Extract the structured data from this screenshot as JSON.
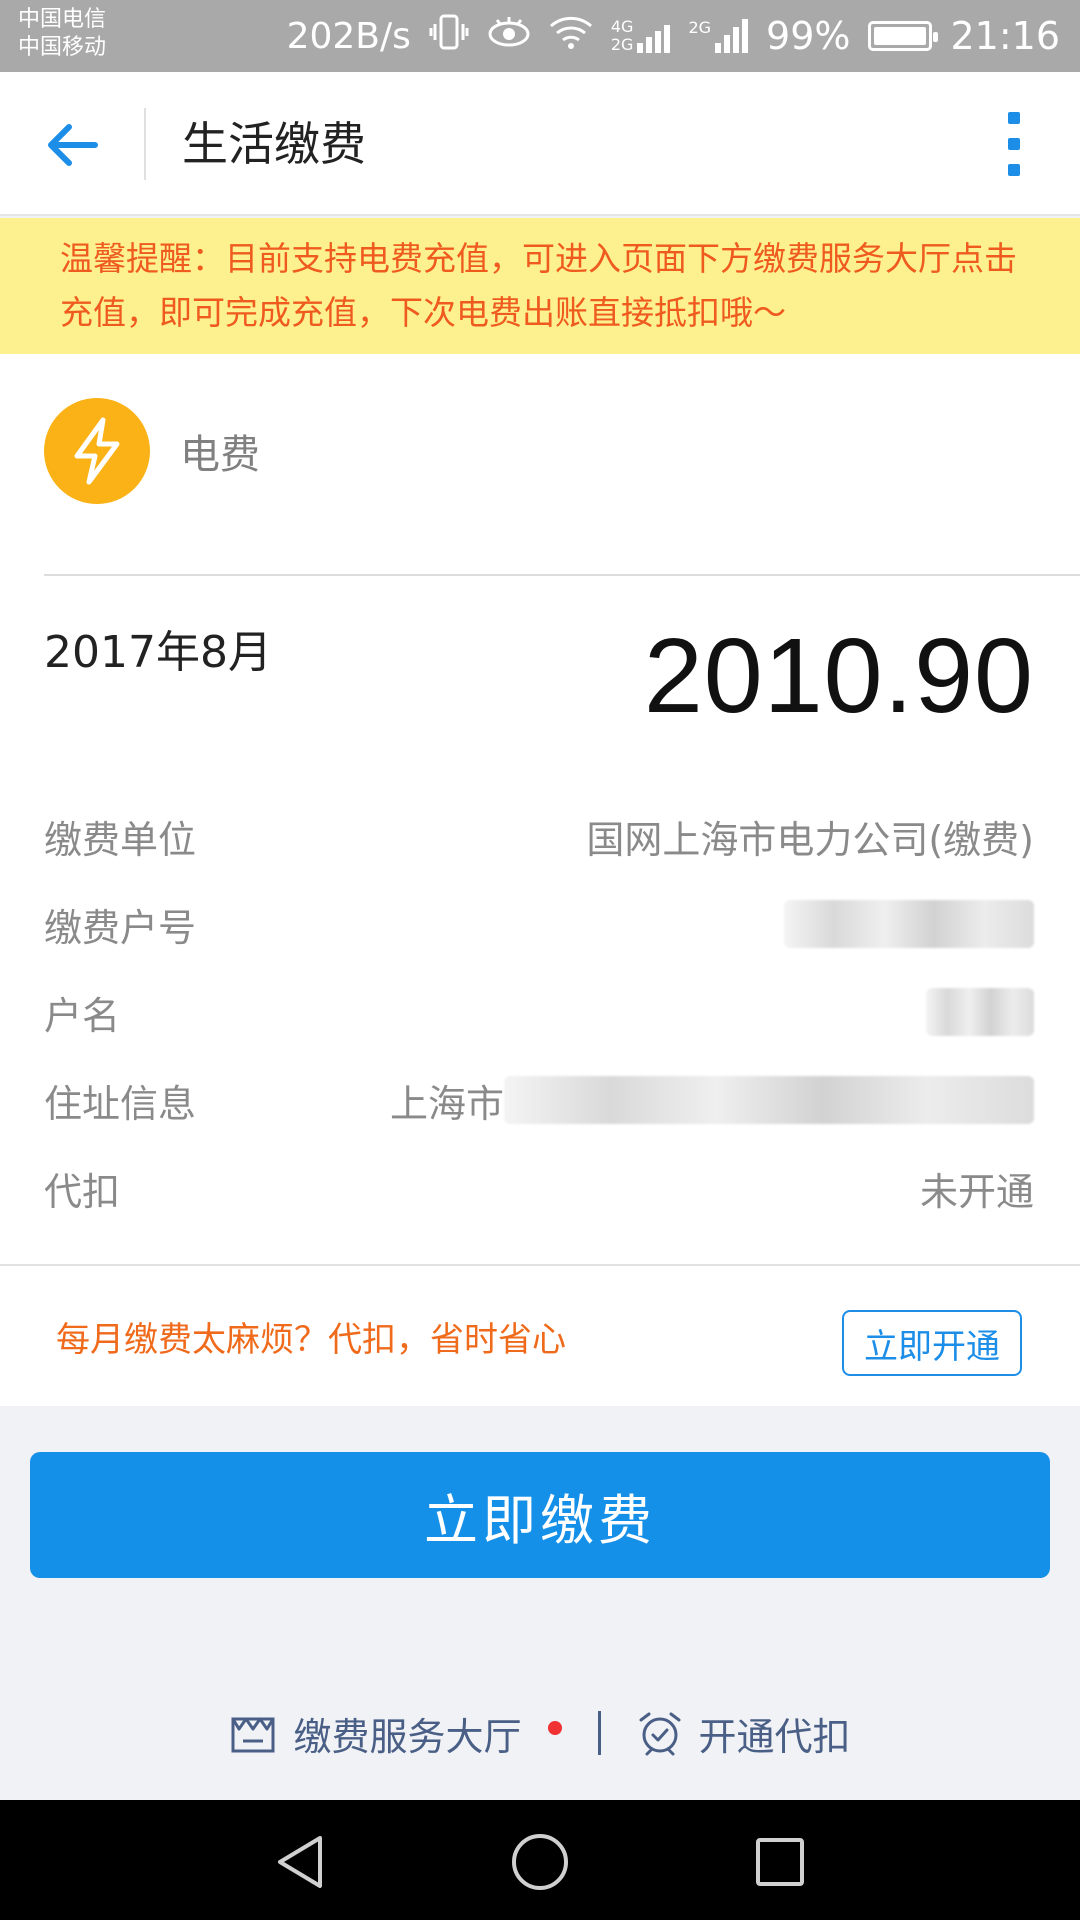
{
  "status_bar": {
    "carrier_1": "中国电信",
    "carrier_2": "中国移动",
    "net_speed": "202B/s",
    "battery": "99%",
    "time": "21:16",
    "network_label_a": "4G",
    "network_label_b": "2G",
    "network_label_c": "2G"
  },
  "header": {
    "title": "生活缴费"
  },
  "notice": {
    "text": "温馨提醒：目前支持电费充值，可进入页面下方缴费服务大厅点击充值，即可完成充值，下次电费出账直接抵扣哦～"
  },
  "bill": {
    "type_label": "电费",
    "month": "2017年8月",
    "amount": "2010.90",
    "rows": [
      {
        "label": "缴费单位",
        "value": "国网上海市电力公司(缴费)"
      },
      {
        "label": "缴费户号",
        "value": ""
      },
      {
        "label": "户名",
        "value": ""
      },
      {
        "label": "住址信息",
        "value": "上海市"
      },
      {
        "label": "代扣",
        "value": "未开通"
      }
    ]
  },
  "promo": {
    "text": "每月缴费太麻烦？代扣，省时省心",
    "button": "立即开通"
  },
  "pay_button": "立即缴费",
  "bottom_links": {
    "service_hall": "缴费服务大厅",
    "auto_deduct": "开通代扣"
  },
  "colors": {
    "primary": "#1590e8",
    "notice_bg": "#fdf18f",
    "notice_text": "#ef5a1f",
    "bolt_bg": "#fbb217",
    "promo_text": "#ef6a1b"
  }
}
